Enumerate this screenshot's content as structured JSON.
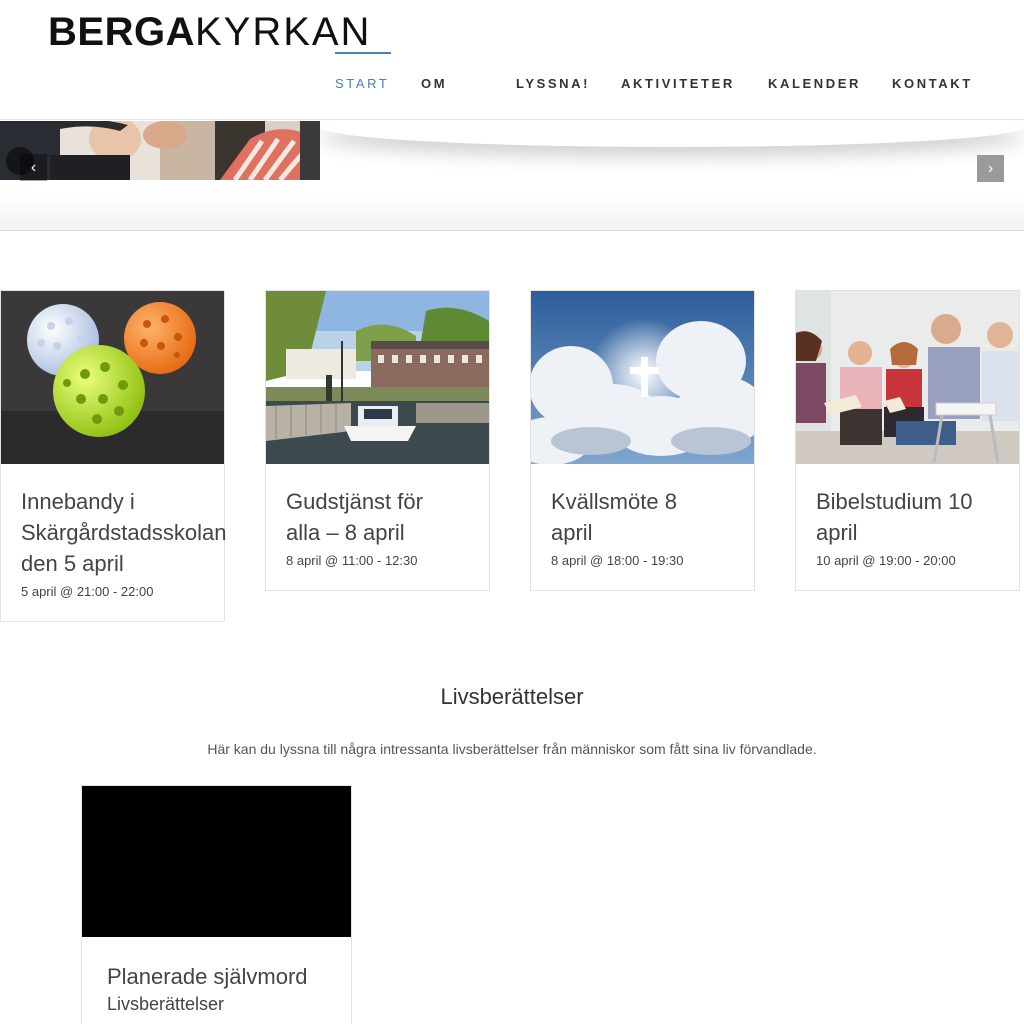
{
  "logo": {
    "bold": "BERGA",
    "thin": "KYRKAN"
  },
  "nav": {
    "items": [
      "START",
      "OM",
      "LYSSNA!",
      "AKTIVITETER",
      "KALENDER",
      "KONTAKT"
    ],
    "active": "START"
  },
  "slider": {
    "prev_icon": "chevron-left-icon",
    "next_icon": "chevron-right-icon"
  },
  "events": [
    {
      "title_lines": [
        "Innebandy i",
        "Skärgårdstadsskolan",
        "den 5 april"
      ],
      "date": "5 april @ 21:00 - 22:00",
      "image": "floorball-balls"
    },
    {
      "title_lines": [
        "Gudstjänst för",
        "alla – 8 april"
      ],
      "date": "8 april @ 11:00 - 12:30",
      "image": "harbor-boat"
    },
    {
      "title_lines": [
        "Kvällsmöte 8",
        "april"
      ],
      "date": "8 april @ 18:00 - 19:30",
      "image": "cross-clouds"
    },
    {
      "title_lines": [
        "Bibelstudium 10",
        "april"
      ],
      "date": "10 april @ 19:00 - 20:00",
      "image": "group-bible-study"
    }
  ],
  "stories_section": {
    "title": "Livsberättelser",
    "description": "Här kan du lyssna till några intressanta livsberättelser från människor som fått sina liv förvandlade.",
    "items": [
      {
        "title": "Planerade självmord",
        "category": "Livsberättelser"
      }
    ]
  },
  "colors": {
    "accent": "#4a7fb8",
    "text": "#444444",
    "border": "#e2e2e2"
  }
}
